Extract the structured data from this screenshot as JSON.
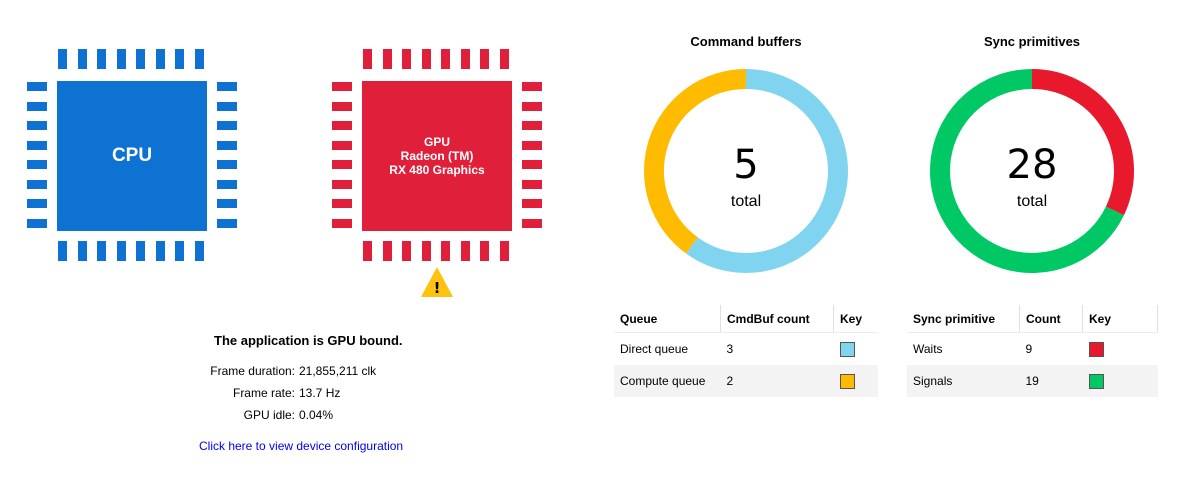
{
  "cpu": {
    "label": "CPU",
    "color": "#0d72d1"
  },
  "gpu": {
    "label_line1": "GPU",
    "label_line2": "Radeon (TM)",
    "label_line3": "RX 480 Graphics",
    "color": "#e0203a",
    "warning_icon": "warning-triangle-icon",
    "warning_mark": "!"
  },
  "summary": {
    "bound_text": "The application is GPU bound.",
    "stats": [
      {
        "label": "Frame duration:",
        "value": "21,855,211 clk"
      },
      {
        "label": "Frame rate:",
        "value": "13.7 Hz"
      },
      {
        "label": "GPU idle:",
        "value": "0.04%"
      }
    ],
    "link_text": "Click here to view device configuration"
  },
  "command_buffers": {
    "title": "Command buffers",
    "total": "5",
    "total_label": "total",
    "table": {
      "headers": [
        "Queue",
        "CmdBuf count",
        "Key"
      ],
      "rows": [
        {
          "name": "Direct queue",
          "count": "3",
          "color": "#80d4f0"
        },
        {
          "name": "Compute queue",
          "count": "2",
          "color": "#ffbb00"
        }
      ]
    }
  },
  "sync_primitives": {
    "title": "Sync primitives",
    "total": "28",
    "total_label": "total",
    "table": {
      "headers": [
        "Sync primitive",
        "Count",
        "Key"
      ],
      "rows": [
        {
          "name": "Waits",
          "count": "9",
          "color": "#e8192d"
        },
        {
          "name": "Signals",
          "count": "19",
          "color": "#00c864"
        }
      ]
    }
  }
}
